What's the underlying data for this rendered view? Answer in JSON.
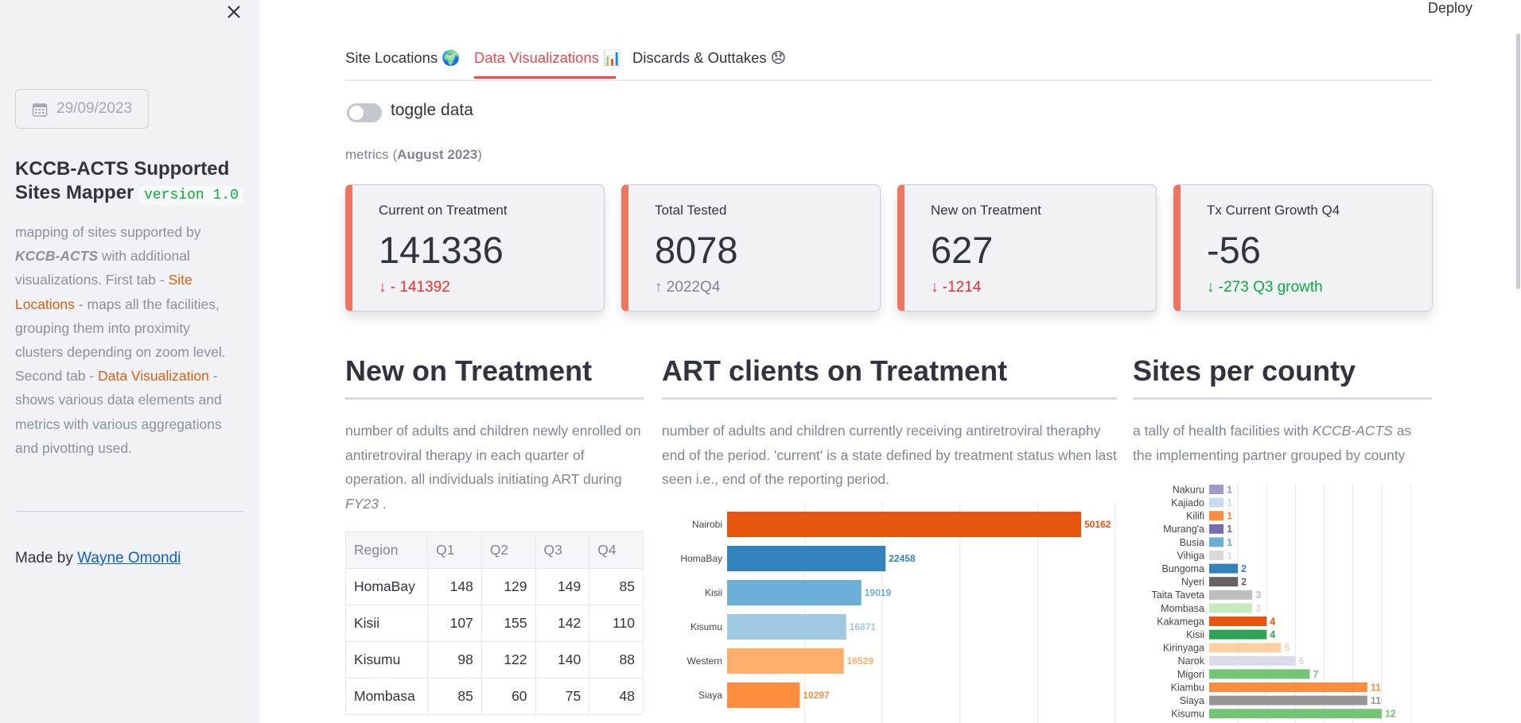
{
  "sidebar": {
    "date": "29/09/2023",
    "title": "KCCB-ACTS Supported Sites Mapper",
    "version": "version 1.0",
    "desc": {
      "p1": "mapping of sites supported by",
      "brand": "KCCB-ACTS",
      "p2": "with additional visualizations. First tab -",
      "hl1": "Site Locations",
      "p3": "- maps all the facilities, grouping them into proximity clusters depending on zoom level. Second tab -",
      "hl2": "Data Visualization",
      "p4": "- shows various data elements and metrics with various aggregations and pivotting used."
    },
    "made_by_prefix": "Made by",
    "made_by_name": "Wayne Omondi"
  },
  "header": {
    "deploy": "Deploy"
  },
  "tabs": [
    {
      "label": "Site Locations 🌍"
    },
    {
      "label": "Data Visualizations 📊"
    },
    {
      "label": "Discards & Outtakes 😞"
    }
  ],
  "toggle": {
    "label": "toggle data",
    "on": false
  },
  "metrics_caption": {
    "prefix": "metrics (",
    "period": "August 2023",
    "suffix": ")"
  },
  "metrics": [
    {
      "label": "Current on Treatment",
      "value": "141336",
      "delta": "- 141392",
      "arrow": "↓",
      "delta_color": "#ff2b2b"
    },
    {
      "label": "Total Tested",
      "value": "8078",
      "delta": "2022Q4",
      "arrow": "↑",
      "delta_color": "#808495"
    },
    {
      "label": "New on Treatment",
      "value": "627",
      "delta": "-1214",
      "arrow": "↓",
      "delta_color": "#ff2b2b"
    },
    {
      "label": "Tx Current Growth Q4",
      "value": "-56",
      "delta": "-273 Q3 growth",
      "arrow": "↓",
      "delta_color": "#09ab3b"
    }
  ],
  "sections": {
    "new_tx": {
      "title": "New on Treatment",
      "desc_main": "number of adults and children newly enrolled on antiretroviral therapy in each quarter of operation. all individuals initiating ART during",
      "desc_em": "FY23",
      "desc_tail": "."
    },
    "art": {
      "title": "ART clients on Treatment",
      "desc": "number of adults and children currently receiving antiretroviral theraphy end of the period. 'current' is a state defined by treatment status when last seen i.e., end of the reporting period."
    },
    "sites": {
      "title": "Sites per county",
      "desc_main": "a tally of health facilities with",
      "desc_em": "KCCB-ACTS",
      "desc_tail": "as the implementing partner grouped by county"
    }
  },
  "table": {
    "headers": [
      "Region",
      "Q1",
      "Q2",
      "Q3",
      "Q4"
    ],
    "rows": [
      [
        "HomaBay",
        "148",
        "129",
        "149",
        "85"
      ],
      [
        "Kisii",
        "107",
        "155",
        "142",
        "110"
      ],
      [
        "Kisumu",
        "98",
        "122",
        "140",
        "88"
      ],
      [
        "Mombasa",
        "85",
        "60",
        "75",
        "48"
      ]
    ]
  },
  "chart_data": [
    {
      "type": "bar",
      "orientation": "horizontal",
      "categories": [
        "Nairobi",
        "HomaBay",
        "Kisii",
        "Kisumu",
        "Western",
        "Siaya"
      ],
      "values": [
        50162,
        22458,
        19019,
        16871,
        16529,
        10297
      ],
      "colors": [
        "#e6550d",
        "#3182bd",
        "#6baed6",
        "#9ecae1",
        "#fdae6b",
        "#fd8d3c"
      ],
      "title": "",
      "xlabel": "",
      "ylabel": "",
      "xlim": [
        0,
        55000
      ],
      "grid": true
    },
    {
      "type": "bar",
      "orientation": "horizontal",
      "categories": [
        "Nakuru",
        "Kajiado",
        "Kilifi",
        "Murang'a",
        "Busia",
        "Vihiga",
        "Bungoma",
        "Nyeri",
        "Taita Taveta",
        "Mombasa",
        "Kakamega",
        "Kisii",
        "Kirinyaga",
        "Narok",
        "Migori",
        "Kiambu",
        "Siaya",
        "Kisumu"
      ],
      "values": [
        1,
        1,
        1,
        1,
        1,
        1,
        2,
        2,
        3,
        3,
        4,
        4,
        5,
        6,
        7,
        11,
        11,
        12
      ],
      "colors": [
        "#9e9ac8",
        "#c6dbef",
        "#fd8d3c",
        "#756bb1",
        "#6baed6",
        "#d9d9d9",
        "#3182bd",
        "#636363",
        "#bdbdbd",
        "#c7e9c0",
        "#e6550d",
        "#31a354",
        "#fdd0a2",
        "#dadaeb",
        "#74c476",
        "#fd8d3c",
        "#969696",
        "#74c476"
      ],
      "title": "",
      "xlabel": "",
      "ylabel": "",
      "xlim": [
        0,
        14
      ],
      "grid": true
    }
  ]
}
